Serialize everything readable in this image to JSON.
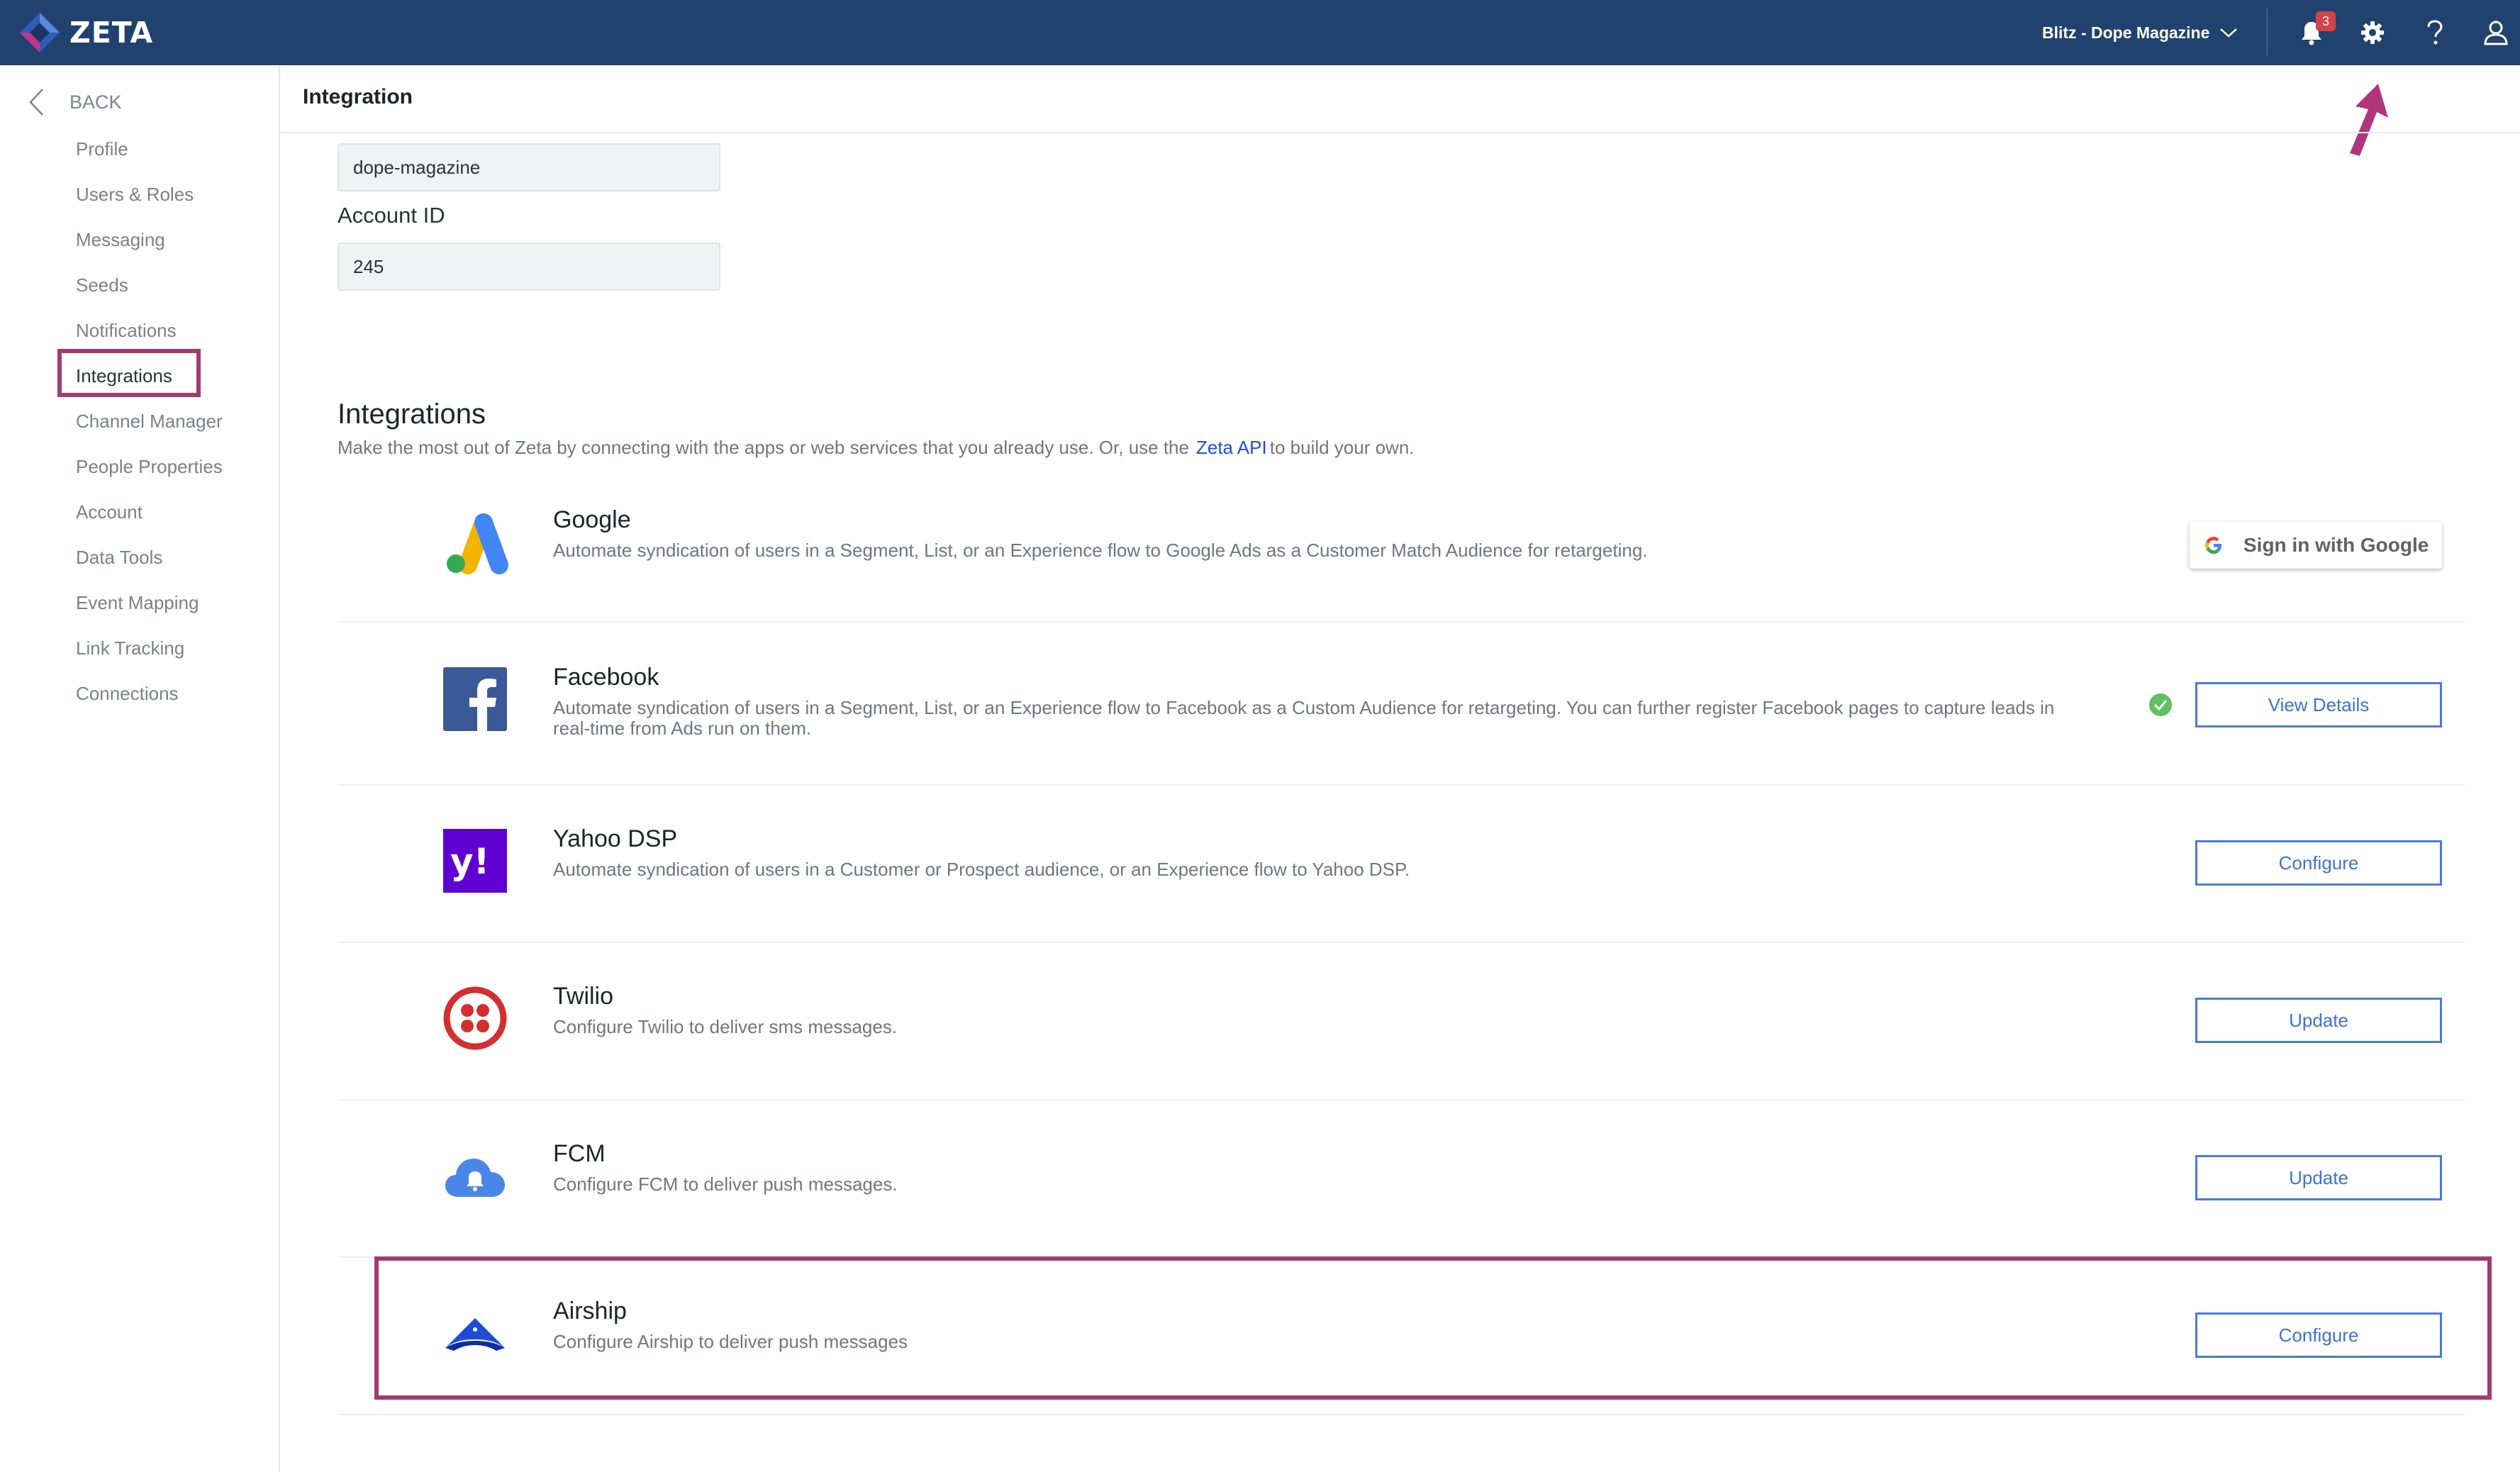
{
  "app": {
    "name": "ZETA"
  },
  "topbar": {
    "account_name": "Blitz - Dope Magazine",
    "notification_count": "3",
    "icons": [
      "bell-icon",
      "gear-icon",
      "help-icon",
      "user-icon"
    ]
  },
  "sidebar": {
    "back_label": "BACK",
    "items": [
      {
        "label": "Profile"
      },
      {
        "label": "Users & Roles"
      },
      {
        "label": "Messaging"
      },
      {
        "label": "Seeds"
      },
      {
        "label": "Notifications"
      },
      {
        "label": "Integrations",
        "active": true
      },
      {
        "label": "Channel Manager"
      },
      {
        "label": "People Properties"
      },
      {
        "label": "Account"
      },
      {
        "label": "Data Tools"
      },
      {
        "label": "Event Mapping"
      },
      {
        "label": "Link Tracking"
      },
      {
        "label": "Connections"
      }
    ]
  },
  "header": {
    "title": "Integration"
  },
  "account": {
    "site_value": "dope-magazine",
    "account_id_label": "Account ID",
    "account_id_value": "245"
  },
  "integrations": {
    "title": "Integrations",
    "desc_before": "Make the most out of Zeta by connecting with the apps or web services that you already use. Or, use the",
    "api_link": "Zeta API",
    "desc_after": "to build your own.",
    "items": [
      {
        "name": "Google",
        "description": "Automate syndication of users in a Segment, List, or an Experience flow to Google Ads as a Customer Match Audience for retargeting.",
        "action": "Sign in with Google"
      },
      {
        "name": "Facebook",
        "description": "Automate syndication of users in a Segment, List, or an Experience flow to Facebook as a Custom Audience for retargeting. You can further register Facebook pages to capture leads in real-time from Ads run on them.",
        "action": "View Details",
        "connected": true
      },
      {
        "name": "Yahoo DSP",
        "description": "Automate syndication of users in a Customer or Prospect audience, or an Experience flow to Yahoo DSP.",
        "action": "Configure"
      },
      {
        "name": "Twilio",
        "description": "Configure Twilio to deliver sms messages.",
        "action": "Update"
      },
      {
        "name": "FCM",
        "description": "Configure FCM to deliver push messages.",
        "action": "Update"
      },
      {
        "name": "Airship",
        "description": "Configure Airship to deliver push messages",
        "action": "Configure"
      }
    ]
  },
  "colors": {
    "topbar": "#21426e",
    "accent": "#3f72d4",
    "highlight": "#a13b72",
    "success": "#5cc15f"
  }
}
